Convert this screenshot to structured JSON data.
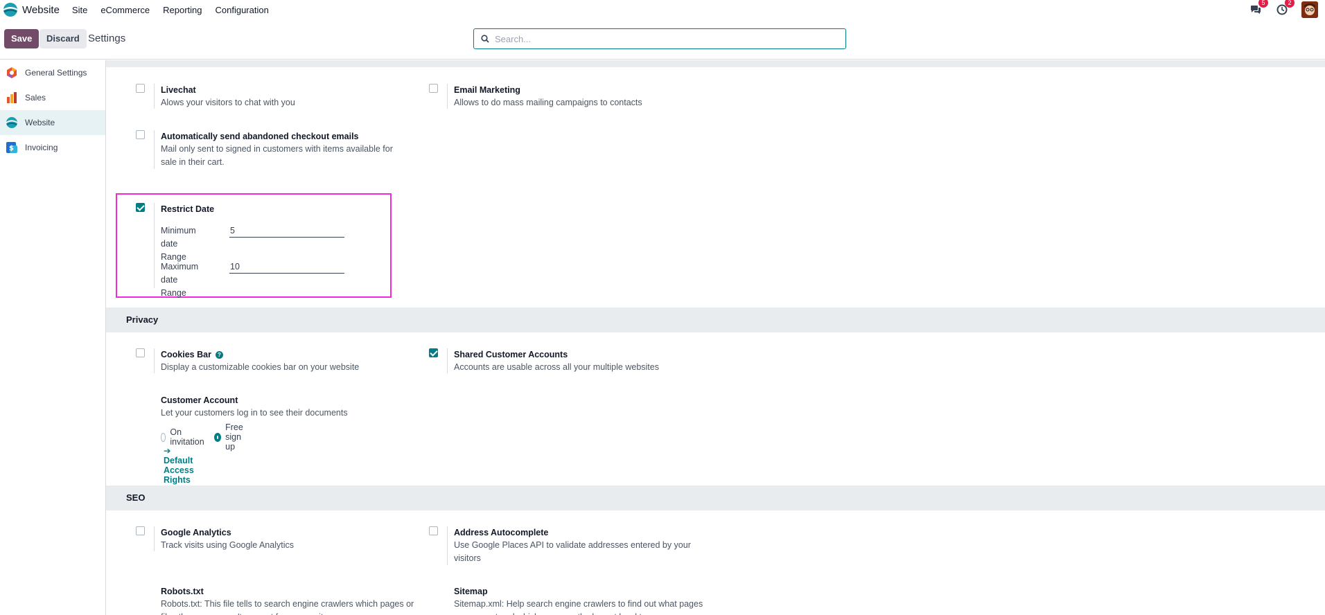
{
  "topnav": {
    "brand": "Website",
    "menu": [
      "Site",
      "eCommerce",
      "Reporting",
      "Configuration"
    ],
    "chat_badge": "5",
    "activity_badge": "2"
  },
  "controlbar": {
    "save_label": "Save",
    "discard_label": "Discard",
    "breadcrumb": "Settings",
    "search_placeholder": "Search..."
  },
  "sidebar": {
    "items": [
      {
        "label": "General Settings",
        "icon": "general-settings-icon"
      },
      {
        "label": "Sales",
        "icon": "sales-icon"
      },
      {
        "label": "Website",
        "icon": "website-icon",
        "active": true
      },
      {
        "label": "Invoicing",
        "icon": "invoicing-icon"
      }
    ]
  },
  "settings": {
    "livechat": {
      "title": "Livechat",
      "desc": "Alows your visitors to chat with you",
      "checked": false
    },
    "email_marketing": {
      "title": "Email Marketing",
      "desc": "Allows to do mass mailing campaigns to contacts",
      "checked": false
    },
    "abandoned": {
      "title": "Automatically send abandoned checkout emails",
      "desc": "Mail only sent to signed in customers with items available for sale in their cart.",
      "checked": false
    },
    "restrict_date": {
      "title": "Restrict Date",
      "checked": true,
      "min_label_1": "Minimum",
      "min_label_2": "date Range",
      "min_value": "5",
      "max_label_1": "Maximum",
      "max_label_2": "date Range",
      "max_value": "10"
    }
  },
  "privacy": {
    "heading": "Privacy",
    "cookies_bar": {
      "title": "Cookies Bar",
      "desc": "Display a customizable cookies bar on your website",
      "checked": false
    },
    "shared_accounts": {
      "title": "Shared Customer Accounts",
      "desc": "Accounts are usable across all your multiple websites",
      "checked": true
    },
    "customer_account": {
      "title": "Customer Account",
      "desc": "Let your customers log in to see their documents",
      "option_invitation": "On invitation",
      "option_signup": "Free sign up",
      "selected": "Free sign up",
      "link": "Default Access Rights"
    }
  },
  "seo": {
    "heading": "SEO",
    "google_analytics": {
      "title": "Google Analytics",
      "desc": "Track visits using Google Analytics",
      "checked": false
    },
    "address_autocomplete": {
      "title": "Address Autocomplete",
      "desc": "Use Google Places API to validate addresses entered by your visitors",
      "checked": false
    },
    "robots": {
      "title": "Robots.txt",
      "desc": "Robots.txt: This file tells to search engine crawlers which pages or files they can or can't request from your site."
    },
    "sitemap": {
      "title": "Sitemap",
      "desc": "Sitemap.xml: Help search engine crawlers to find out what pages are present and which ones are the lowest level to"
    }
  },
  "colors": {
    "brand": "#714B67",
    "accent": "#017e84",
    "badge": "#e11d48",
    "highlight": "#ee2bd6"
  }
}
